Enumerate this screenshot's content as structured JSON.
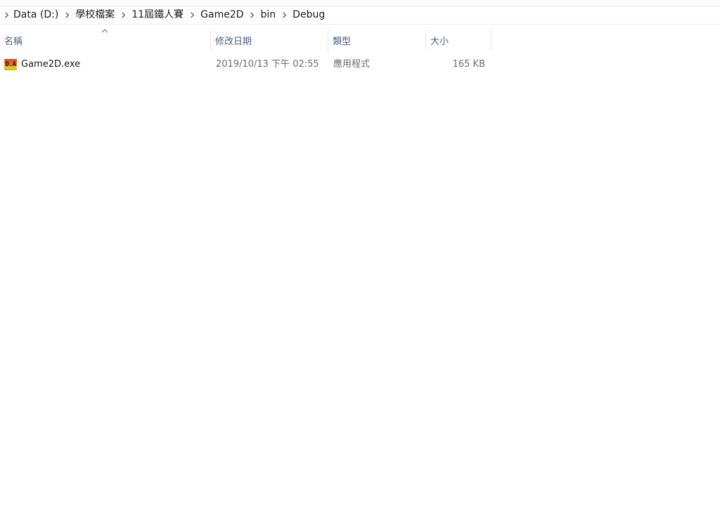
{
  "breadcrumb": {
    "items": [
      {
        "label": "Data (D:)"
      },
      {
        "label": "學校檔案"
      },
      {
        "label": "11屆鐵人賽"
      },
      {
        "label": "Game2D"
      },
      {
        "label": "bin"
      },
      {
        "label": "Debug"
      }
    ]
  },
  "columns": {
    "name": "名稱",
    "date_modified": "修改日期",
    "type": "類型",
    "size": "大小"
  },
  "files": [
    {
      "icon": "app-exe-icon",
      "icon_text": "D.A",
      "name": "Game2D.exe",
      "date_modified": "2019/10/13 下午 02:55",
      "type": "應用程式",
      "size": "165 KB"
    }
  ],
  "colors": {
    "header_text": "#4c607a",
    "meta_text": "#6d6d6d"
  }
}
